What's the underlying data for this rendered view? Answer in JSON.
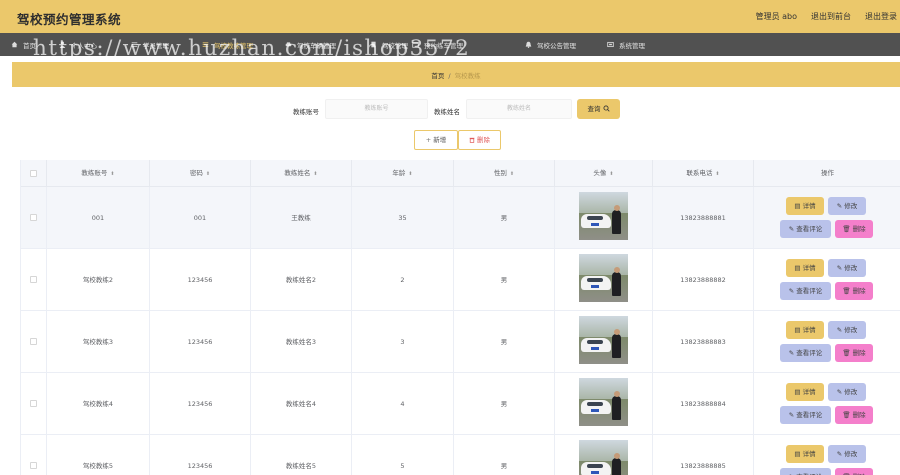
{
  "app": {
    "title": "驾校预约管理系统",
    "user_label": "管理员 abo",
    "back_label": "退出到前台",
    "logout_label": "退出登录"
  },
  "nav": [
    {
      "label": "首页",
      "icon": "home-icon"
    },
    {
      "label": "个人中心",
      "icon": "user-icon"
    },
    {
      "label": "学员管理",
      "icon": "list-icon"
    },
    {
      "label": "驾校教练管理",
      "icon": "list-icon"
    },
    {
      "label": "驾校车辆管理",
      "icon": "car-icon"
    },
    {
      "label": "驾校管理",
      "icon": "building-icon"
    },
    {
      "label": "预约练车管理",
      "icon": "calendar-icon"
    },
    {
      "label": "驾校公告管理",
      "icon": "bell-icon"
    },
    {
      "label": "系统管理",
      "icon": "settings-icon"
    }
  ],
  "watermark": "https://www.huzhan.com/ishop3572",
  "breadcrumb": {
    "home": "首页",
    "separator": "/",
    "current": "驾校教练"
  },
  "search": {
    "account_label": "教练账号",
    "account_placeholder": "教练账号",
    "name_label": "教练姓名",
    "name_placeholder": "教练姓名",
    "button_label": "查询"
  },
  "actions": {
    "add_label": "新增",
    "delete_label": "删除"
  },
  "table": {
    "columns": [
      "教练账号",
      "密码",
      "教练姓名",
      "年龄",
      "性别",
      "头像",
      "联系电话",
      "操作"
    ],
    "rows": [
      {
        "account": "001",
        "password": "001",
        "name": "王教练",
        "age": "35",
        "gender": "男",
        "phone": "13823888881"
      },
      {
        "account": "驾校教练2",
        "password": "123456",
        "name": "教练姓名2",
        "age": "2",
        "gender": "男",
        "phone": "13823888882"
      },
      {
        "account": "驾校教练3",
        "password": "123456",
        "name": "教练姓名3",
        "age": "3",
        "gender": "男",
        "phone": "13823888883"
      },
      {
        "account": "驾校教练4",
        "password": "123456",
        "name": "教练姓名4",
        "age": "4",
        "gender": "男",
        "phone": "13823888884"
      },
      {
        "account": "驾校教练5",
        "password": "123456",
        "name": "教练姓名5",
        "age": "5",
        "gender": "男",
        "phone": "13823888885"
      }
    ],
    "row_actions": {
      "detail": "详情",
      "edit": "修改",
      "review": "查看评论",
      "delete": "删除"
    }
  },
  "colors": {
    "accent": "#ebc86b",
    "nav_bg": "#515151",
    "edit": "#b9c2ea",
    "danger": "#f47fcb"
  }
}
